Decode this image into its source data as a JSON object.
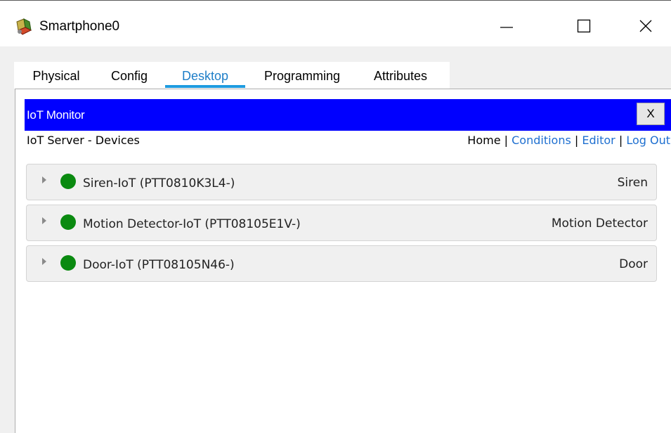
{
  "window": {
    "title": "Smartphone0",
    "icon": "smartphone-app-icon"
  },
  "tabs": [
    {
      "label": "Physical",
      "active": false
    },
    {
      "label": "Config",
      "active": false
    },
    {
      "label": "Desktop",
      "active": true
    },
    {
      "label": "Programming",
      "active": false
    },
    {
      "label": "Attributes",
      "active": false
    }
  ],
  "iot_monitor": {
    "title": "IoT Monitor",
    "close_label": "X",
    "subtitle": "IoT Server - Devices",
    "nav": {
      "home": "Home",
      "conditions": "Conditions",
      "editor": "Editor",
      "logout": "Log Out",
      "separator": "|"
    }
  },
  "devices": [
    {
      "name": "Siren-IoT (PTT0810K3L4-)",
      "type": "Siren",
      "status_color": "#0a8a10"
    },
    {
      "name": "Motion Detector-IoT (PTT08105E1V-)",
      "type": "Motion Detector",
      "status_color": "#0a8a10"
    },
    {
      "name": "Door-IoT (PTT08105N46-)",
      "type": "Door",
      "status_color": "#0a8a10"
    }
  ],
  "colors": {
    "header_bg": "#0000ff",
    "active_tab": "#1e7ec8",
    "link": "#1e6fd0"
  }
}
